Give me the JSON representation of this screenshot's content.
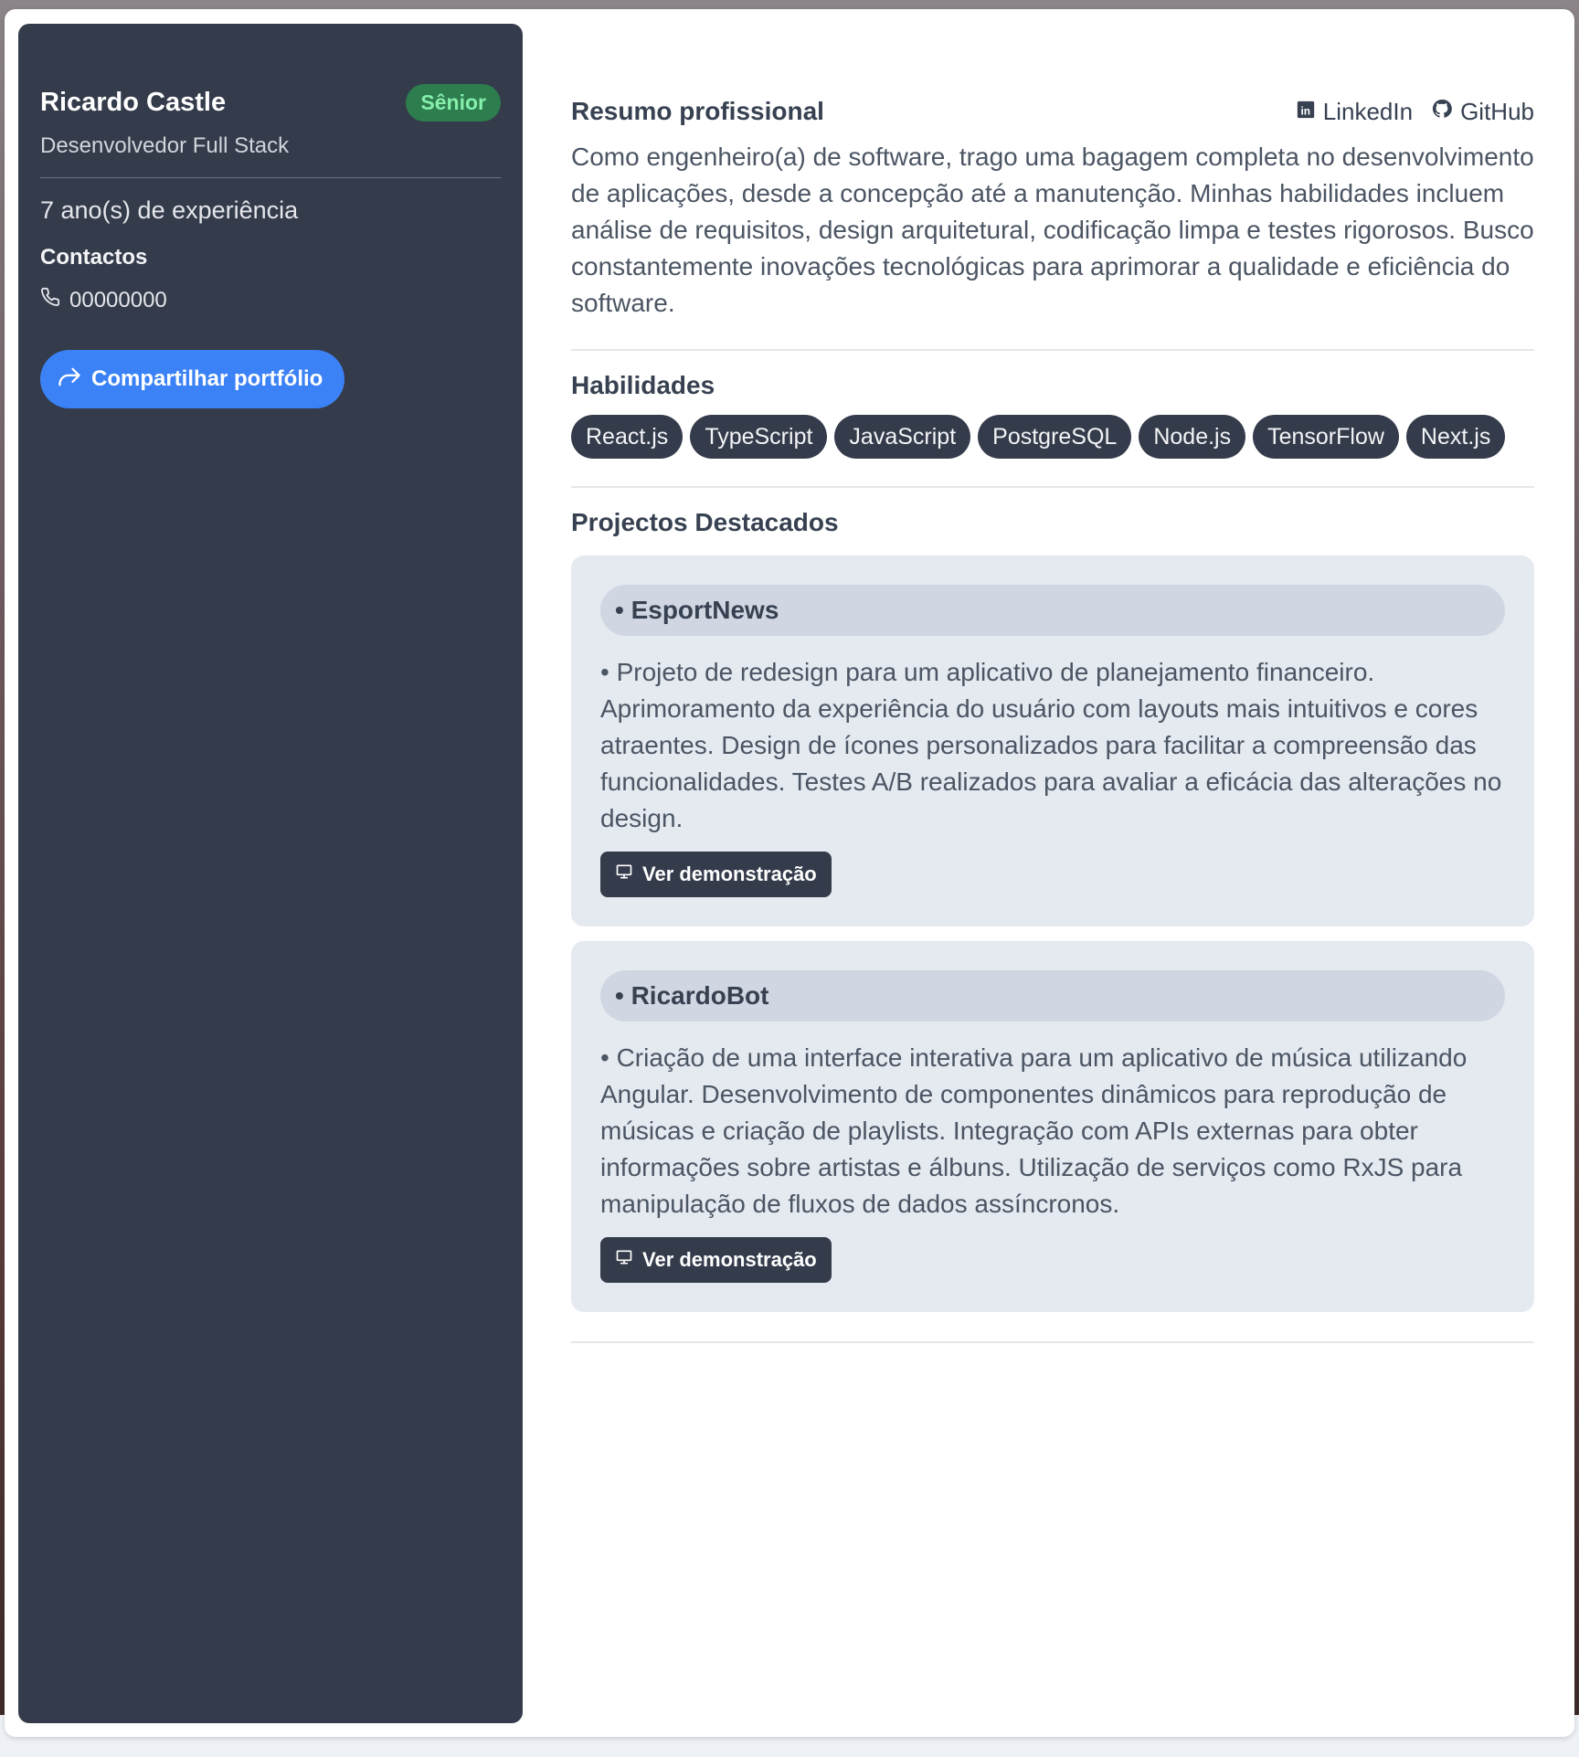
{
  "profile": {
    "name": "Ricardo Castle",
    "level": "Sênior",
    "role": "Desenvolvedor Full Stack",
    "experience": "7 ano(s) de experiência",
    "contacts_title": "Contactos",
    "phone": "00000000",
    "share_label": "Compartilhar portfólio"
  },
  "summary": {
    "title": "Resumo profissional",
    "linkedin_label": "LinkedIn",
    "github_label": "GitHub",
    "text": "Como engenheiro(a) de software, trago uma bagagem completa no desenvolvimento de aplicações, desde a concepção até a manutenção. Minhas habilidades incluem análise de requisitos, design arquitetural, codificação limpa e testes rigorosos. Busco constantemente inovações tecnológicas para aprimorar a qualidade e eficiência do software."
  },
  "skills": {
    "title": "Habilidades",
    "items": [
      "React.js",
      "TypeScript",
      "JavaScript",
      "PostgreSQL",
      "Node.js",
      "TensorFlow",
      "Next.js"
    ]
  },
  "projects": {
    "title": "Projectos Destacados",
    "items": [
      {
        "name": "• EsportNews",
        "description": "• Projeto de redesign para um aplicativo de planejamento financeiro. Aprimoramento da experiência do usuário com layouts mais intuitivos e cores atraentes. Design de ícones personalizados para facilitar a compreensão das funcionalidades. Testes A/B realizados para avaliar a eficácia das alterações no design.",
        "demo_label": "Ver demonstração"
      },
      {
        "name": "• RicardoBot",
        "description": "• Criação de uma interface interativa para um aplicativo de música utilizando Angular. Desenvolvimento de componentes dinâmicos para reprodução de músicas e criação de playlists. Integração com APIs externas para obter informações sobre artistas e álbuns. Utilização de serviços como RxJS para manipulação de fluxos de dados assíncronos.",
        "demo_label": "Ver demonstração"
      }
    ]
  },
  "colors": {
    "sidebar": "#343b4b",
    "accent": "#3b82f6",
    "level_badge": "#2e7d4f"
  },
  "icons": [
    "phone-icon",
    "share-icon",
    "linkedin-icon",
    "github-icon",
    "presentation-icon"
  ]
}
